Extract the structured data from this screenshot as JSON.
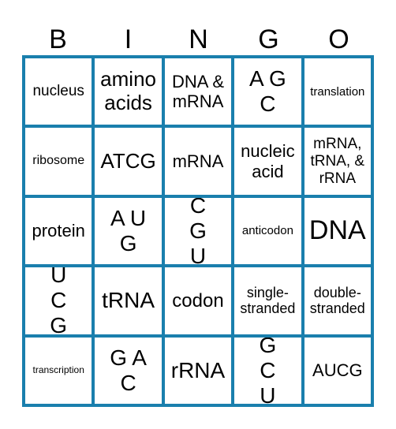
{
  "header": [
    "B",
    "I",
    "N",
    "G",
    "O"
  ],
  "border_color": "#1a7fad",
  "cells": [
    [
      "nucleus",
      "amino acids",
      "DNA & mRNA",
      "A G C",
      "translation"
    ],
    [
      "ribosome",
      "ATCG",
      "mRNA",
      "nucleic acid",
      "mRNA, tRNA, & rRNA"
    ],
    [
      "protein",
      "A U G",
      "C G U",
      "anticodon",
      "DNA"
    ],
    [
      "U C G",
      "tRNA",
      "codon",
      "single-stranded",
      "double-stranded"
    ],
    [
      "transcription",
      "G A C",
      "rRNA",
      "G C U",
      "AUCG"
    ]
  ]
}
